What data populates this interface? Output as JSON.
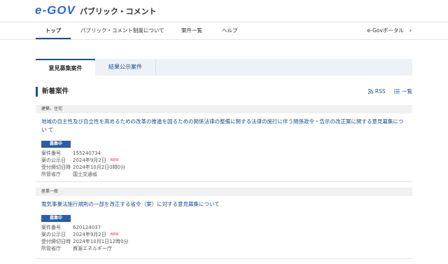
{
  "header": {
    "logo_text": "e-GOV",
    "site_title": "パブリック・コメント"
  },
  "nav": {
    "items": [
      {
        "label": "トップ"
      },
      {
        "label": "パブリック・コメント制度について"
      },
      {
        "label": "案件一覧"
      },
      {
        "label": "ヘルプ"
      }
    ],
    "portal_link": "e-Govポータル"
  },
  "tabs": [
    {
      "label": "意見募集案件",
      "active": true
    },
    {
      "label": "結果公示案件",
      "active": false
    }
  ],
  "section": {
    "title": "新着案件",
    "rss_label": "RSS",
    "list_label": "一覧"
  },
  "cases": [
    {
      "category": "建築、住宅",
      "title": "地域の自主性及び自立性を高めるための改革の推進を図るための関係法律の整備に関する法律の施行に伴う関係政令・告示の改正案に関する意見募集につい て",
      "status": "募集中",
      "fields": [
        {
          "label": "案件番号",
          "value": "155240734",
          "new": ""
        },
        {
          "label": "案の公示日",
          "value": "2024年9月2日",
          "new": "NEW"
        },
        {
          "label": "受付締切日時",
          "value": "2024年10月2日0時0分",
          "new": ""
        },
        {
          "label": "所管省庁",
          "value": "国土交通省",
          "new": ""
        }
      ]
    },
    {
      "category": "産業一般",
      "title": "電気事業法施行規則の一部を改正する省令（案）に対する意見募集について",
      "status": "募集中",
      "fields": [
        {
          "label": "案件番号",
          "value": "620124037",
          "new": ""
        },
        {
          "label": "案の公示日",
          "value": "2024年9月2日",
          "new": "NEW"
        },
        {
          "label": "受付締切日時",
          "value": "2024年10月1日12時0分",
          "new": ""
        },
        {
          "label": "所管省庁",
          "value": "資源エネルギー庁",
          "new": ""
        }
      ]
    }
  ],
  "colors": {
    "brand_blue": "#1d4f91",
    "badge_blue": "#2a5ca8",
    "new_red": "#d9334a"
  }
}
